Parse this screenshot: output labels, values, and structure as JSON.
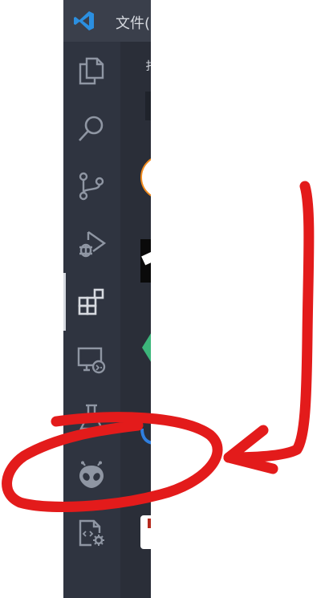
{
  "titlebar": {
    "menu_file": "文件("
  },
  "activity_bar": {
    "items": [
      {
        "name": "explorer",
        "icon": "files-icon"
      },
      {
        "name": "search",
        "icon": "search-icon"
      },
      {
        "name": "source-control",
        "icon": "source-control-icon"
      },
      {
        "name": "run-debug",
        "icon": "run-debug-icon"
      },
      {
        "name": "extensions",
        "icon": "extensions-icon",
        "active": true
      },
      {
        "name": "remote-explorer",
        "icon": "remote-explorer-icon"
      },
      {
        "name": "testing",
        "icon": "testing-flask-icon"
      },
      {
        "name": "alien-extension",
        "icon": "alien-icon"
      },
      {
        "name": "extension-settings",
        "icon": "file-gear-icon"
      }
    ]
  },
  "sidebar": {
    "title_fragment": "扌"
  },
  "colors": {
    "activity_bar_bg": "#2f3440",
    "title_bar_bg": "#3a3f4b",
    "icon_color": "#8f96a3",
    "annotation_red": "#e31b1b"
  }
}
